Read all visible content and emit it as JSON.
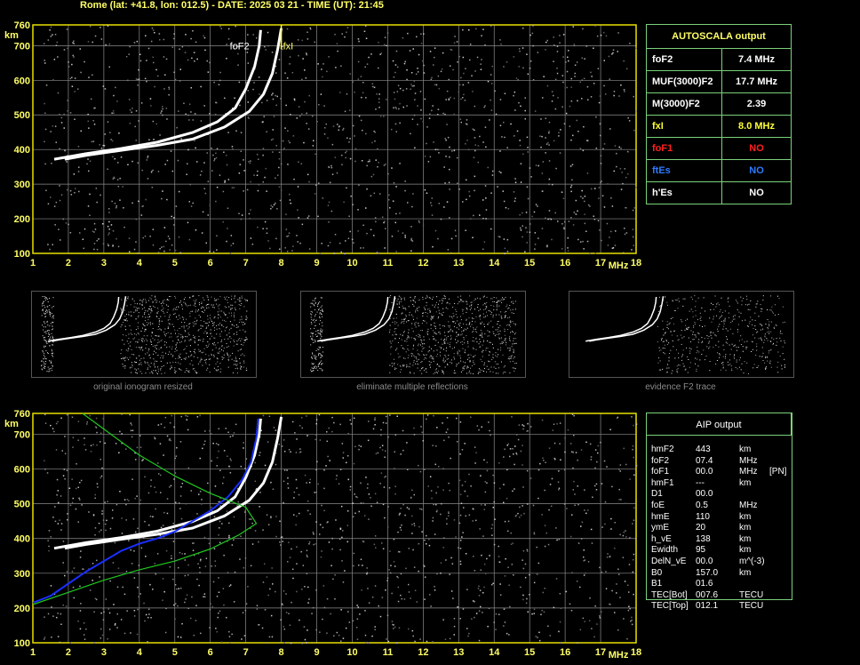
{
  "header": "Rome (lat: +41.8, lon: 012.5) - DATE: 2025 03 21 - TIME (UT): 21:45",
  "axes": {
    "x_ticks": [
      "1",
      "2",
      "3",
      "4",
      "5",
      "6",
      "7",
      "8",
      "9",
      "10",
      "11",
      "12",
      "13",
      "14",
      "15",
      "16",
      "17",
      "18"
    ],
    "x_unit": "MHz",
    "y_ticks": [
      "760",
      "700",
      "600",
      "500",
      "400",
      "300",
      "200",
      "100"
    ],
    "y_unit": "km"
  },
  "labels": {
    "foF2": "foF2",
    "fxI": "fxI"
  },
  "thumbnails": [
    {
      "caption": "original ionogram resized"
    },
    {
      "caption": "eliminate multiple reflections"
    },
    {
      "caption": "evidence F2 trace"
    }
  ],
  "autoscala": {
    "title": "AUTOSCALA output",
    "rows": [
      {
        "name": "foF2",
        "value": "7.4 MHz",
        "color": "#ffffff"
      },
      {
        "name": "MUF(3000)F2",
        "value": "17.7 MHz",
        "color": "#ffffff"
      },
      {
        "name": "M(3000)F2",
        "value": "2.39",
        "color": "#ffffff"
      },
      {
        "name": "fxI",
        "value": "8.0 MHz",
        "color": "#ffff33"
      },
      {
        "name": "foF1",
        "value": "NO",
        "color": "#ff2020"
      },
      {
        "name": "ftEs",
        "value": "NO",
        "color": "#2f7bff"
      },
      {
        "name": "h'Es",
        "value": "NO",
        "color": "#ffffff"
      }
    ]
  },
  "aip": {
    "title": "AIP output",
    "rows": [
      {
        "name": "hmF2",
        "value": "443",
        "unit": "km",
        "extra": ""
      },
      {
        "name": "foF2",
        "value": "07.4",
        "unit": "MHz",
        "extra": ""
      },
      {
        "name": "foF1",
        "value": "00.0",
        "unit": "MHz",
        "extra": "[PN]"
      },
      {
        "name": "hmF1",
        "value": "---",
        "unit": "km",
        "extra": ""
      },
      {
        "name": "D1",
        "value": "00.0",
        "unit": "",
        "extra": ""
      },
      {
        "name": "foE",
        "value": "0.5",
        "unit": "MHz",
        "extra": ""
      },
      {
        "name": "hmE",
        "value": "110",
        "unit": "km",
        "extra": ""
      },
      {
        "name": "ymE",
        "value": "20",
        "unit": "km",
        "extra": ""
      },
      {
        "name": "h_vE",
        "value": "138",
        "unit": "km",
        "extra": ""
      },
      {
        "name": "Ewidth",
        "value": "95",
        "unit": "km",
        "extra": ""
      },
      {
        "name": "DelN_vE",
        "value": "00.0",
        "unit": "m^(-3)",
        "extra": ""
      },
      {
        "name": "B0",
        "value": "157.0",
        "unit": "km",
        "extra": ""
      },
      {
        "name": "B1",
        "value": "01.6",
        "unit": "",
        "extra": ""
      },
      {
        "name": "TEC[Bot]",
        "value": "007.6",
        "unit": "TECU",
        "extra": ""
      },
      {
        "name": "TEC[Top]",
        "value": "012.1",
        "unit": "TECU",
        "extra": ""
      }
    ]
  },
  "colors": {
    "grid": "#8c8c8c",
    "frame": "#e8e000",
    "trace": "#ffffff",
    "profile_blue": "#1a2fff",
    "profile_green": "#1fc81f",
    "table_border": "#7bd17b"
  },
  "chart_data": [
    {
      "type": "scatter",
      "title": "",
      "xlabel": "MHz",
      "ylabel": "km",
      "xlim": [
        1,
        18
      ],
      "ylim": [
        100,
        760
      ],
      "grid": true,
      "series": [
        {
          "values": [
            [
              1.6,
              372
            ],
            [
              2.5,
              388
            ],
            [
              3.5,
              403
            ],
            [
              4.5,
              421
            ],
            [
              5.5,
              449
            ],
            [
              6.2,
              480
            ],
            [
              6.7,
              520
            ],
            [
              7.0,
              575
            ],
            [
              7.25,
              640
            ],
            [
              7.38,
              700
            ],
            [
              7.42,
              745
            ]
          ]
        },
        {
          "values": [
            [
              1.9,
              372
            ],
            [
              2.5,
              383
            ],
            [
              3.5,
              398
            ],
            [
              4.5,
              412
            ],
            [
              5.5,
              430
            ],
            [
              6.4,
              465
            ],
            [
              7.1,
              510
            ],
            [
              7.5,
              560
            ],
            [
              7.75,
              620
            ],
            [
              7.9,
              690
            ],
            [
              8.0,
              750
            ]
          ]
        }
      ]
    },
    {
      "type": "line",
      "title": "",
      "xlabel": "MHz",
      "ylabel": "km",
      "xlim": [
        1,
        18
      ],
      "ylim": [
        100,
        760
      ],
      "grid": true,
      "series": [
        {
          "values": [
            [
              1.6,
              372
            ],
            [
              2.5,
              388
            ],
            [
              3.5,
              403
            ],
            [
              4.5,
              421
            ],
            [
              5.5,
              449
            ],
            [
              6.2,
              480
            ],
            [
              6.7,
              520
            ],
            [
              7.0,
              575
            ],
            [
              7.25,
              640
            ],
            [
              7.38,
              700
            ],
            [
              7.42,
              745
            ]
          ]
        },
        {
          "values": [
            [
              1.9,
              372
            ],
            [
              2.5,
              383
            ],
            [
              3.5,
              398
            ],
            [
              4.5,
              412
            ],
            [
              5.5,
              430
            ],
            [
              6.4,
              465
            ],
            [
              7.1,
              510
            ],
            [
              7.5,
              560
            ],
            [
              7.75,
              620
            ],
            [
              7.9,
              690
            ],
            [
              8.0,
              750
            ]
          ]
        },
        {
          "values": [
            [
              1.0,
              215
            ],
            [
              1.5,
              235
            ],
            [
              2.0,
              270
            ],
            [
              2.5,
              305
            ],
            [
              3.0,
              335
            ],
            [
              3.5,
              365
            ],
            [
              4.0,
              385
            ],
            [
              4.5,
              400
            ],
            [
              5.0,
              420
            ],
            [
              5.5,
              450
            ],
            [
              6.0,
              480
            ],
            [
              6.5,
              520
            ],
            [
              6.9,
              570
            ],
            [
              7.15,
              620
            ],
            [
              7.3,
              690
            ],
            [
              7.35,
              745
            ]
          ]
        },
        {
          "values": [
            [
              1.0,
              210
            ],
            [
              2.0,
              245
            ],
            [
              3.0,
              280
            ],
            [
              4.0,
              310
            ],
            [
              5.0,
              335
            ],
            [
              6.0,
              370
            ],
            [
              6.8,
              410
            ],
            [
              7.3,
              443
            ],
            [
              7.0,
              490
            ],
            [
              6.0,
              530
            ],
            [
              5.0,
              580
            ],
            [
              4.0,
              640
            ],
            [
              3.2,
              700
            ],
            [
              2.4,
              760
            ]
          ]
        }
      ]
    }
  ]
}
